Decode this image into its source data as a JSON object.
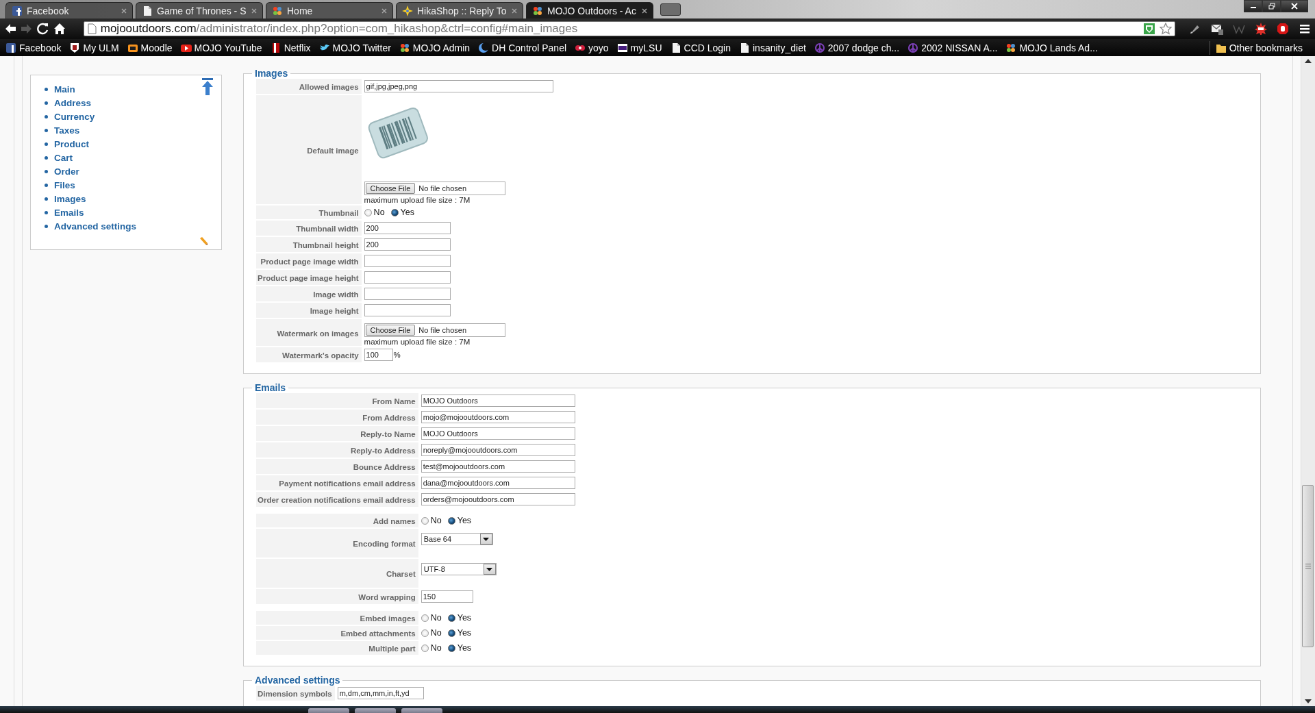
{
  "browser": {
    "tabs": [
      {
        "title": "Facebook",
        "selected": false
      },
      {
        "title": "Game of Thrones - S",
        "selected": false
      },
      {
        "title": "Home",
        "selected": false
      },
      {
        "title": "HikaShop :: Reply To",
        "selected": false
      },
      {
        "title": "MOJO Outdoors - Ac",
        "selected": true
      }
    ],
    "address": {
      "host": "mojooutdoors.com",
      "path": "/administrator/index.php?option=com_hikashop&ctrl=config#main_images"
    },
    "bookmarks": [
      {
        "label": "Facebook"
      },
      {
        "label": "My ULM"
      },
      {
        "label": "Moodle"
      },
      {
        "label": "MOJO YouTube"
      },
      {
        "label": "Netflix"
      },
      {
        "label": "MOJO Twitter"
      },
      {
        "label": "MOJO Admin"
      },
      {
        "label": "DH Control Panel"
      },
      {
        "label": "yoyo"
      },
      {
        "label": "myLSU"
      },
      {
        "label": "CCD Login"
      },
      {
        "label": "insanity_diet"
      },
      {
        "label": "2007 dodge ch..."
      },
      {
        "label": "2002 NISSAN A..."
      },
      {
        "label": "MOJO Lands Ad..."
      }
    ],
    "other_bookmarks": "Other bookmarks"
  },
  "sidebar": {
    "items": [
      "Main",
      "Address",
      "Currency",
      "Taxes",
      "Product",
      "Cart",
      "Order",
      "Files",
      "Images",
      "Emails",
      "Advanced settings"
    ]
  },
  "sections": [
    {
      "title": "Images",
      "rows": [
        {
          "label": "Allowed images",
          "kind": "wide",
          "value": "gif,jpg,jpeg,png"
        },
        {
          "label": "Default image",
          "kind": "image_file",
          "button": "Choose File",
          "status": "No file chosen",
          "note": "maximum upload file size : 7M"
        },
        {
          "label": "Thumbnail",
          "kind": "radio",
          "options": [
            {
              "label": "No",
              "selected": false
            },
            {
              "label": "Yes",
              "selected": true
            }
          ]
        },
        {
          "label": "Thumbnail width",
          "kind": "short",
          "value": "200"
        },
        {
          "label": "Thumbnail height",
          "kind": "short",
          "value": "200"
        },
        {
          "label": "Product page image width",
          "kind": "short"
        },
        {
          "label": "Product page image height",
          "kind": "short"
        },
        {
          "label": "Image width",
          "kind": "short"
        },
        {
          "label": "Image height",
          "kind": "short"
        },
        {
          "label": "Watermark on images",
          "kind": "file",
          "button": "Choose File",
          "status": "No file chosen",
          "note": "maximum upload file size : 7M"
        },
        {
          "label": "Watermark's opacity",
          "kind": "percent",
          "value": "100",
          "unit": "%"
        }
      ]
    },
    {
      "title": "Emails",
      "rows": [
        {
          "label": "From Name",
          "kind": "text",
          "value": "MOJO Outdoors"
        },
        {
          "label": "From Address",
          "kind": "text",
          "value": "mojo@mojooutdoors.com"
        },
        {
          "label": "Reply-to Name",
          "kind": "text",
          "value": "MOJO Outdoors"
        },
        {
          "label": "Reply-to Address",
          "kind": "text",
          "value": "noreply@mojooutdoors.com"
        },
        {
          "label": "Bounce Address",
          "kind": "text",
          "value": "test@mojooutdoors.com"
        },
        {
          "label": "Payment notifications email address",
          "kind": "text",
          "value": "dana@mojooutdoors.com"
        },
        {
          "label": "Order creation notifications email address",
          "kind": "text",
          "value": "orders@mojooutdoors.com"
        },
        {
          "label": "Add names",
          "kind": "radio",
          "options": [
            {
              "label": "No",
              "selected": false
            },
            {
              "label": "Yes",
              "selected": true
            }
          ]
        },
        {
          "label": "Encoding format",
          "kind": "select",
          "value": "Base 64"
        },
        {
          "label": "Charset",
          "kind": "select",
          "value": "UTF-8"
        },
        {
          "label": "Word wrapping",
          "kind": "medium",
          "value": "150"
        },
        {
          "label": "Embed images",
          "kind": "radio",
          "options": [
            {
              "label": "No",
              "selected": false
            },
            {
              "label": "Yes",
              "selected": true
            }
          ]
        },
        {
          "label": "Embed attachments",
          "kind": "radio",
          "options": [
            {
              "label": "No",
              "selected": false
            },
            {
              "label": "Yes",
              "selected": true
            }
          ]
        },
        {
          "label": "Multiple part",
          "kind": "radio",
          "options": [
            {
              "label": "No",
              "selected": false
            },
            {
              "label": "Yes",
              "selected": true
            }
          ]
        }
      ]
    },
    {
      "title": "Advanced settings",
      "rows": [
        {
          "label": "Dimension symbols",
          "kind": "short",
          "value": "m,dm,cm,mm,in,ft,yd"
        }
      ]
    }
  ]
}
